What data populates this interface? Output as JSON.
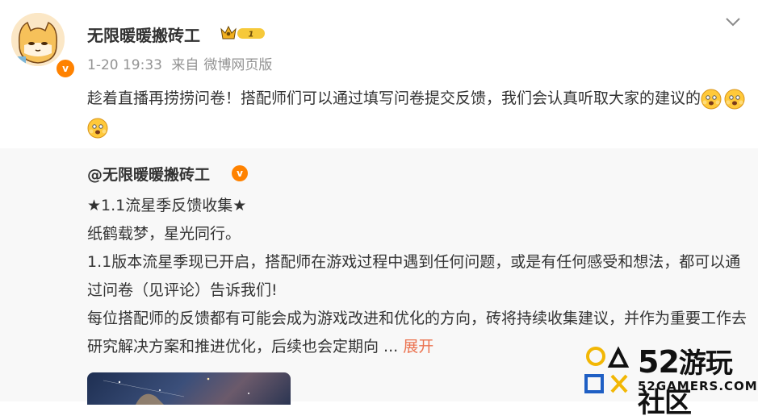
{
  "post": {
    "username": "无限暖暖搬砖工",
    "vip_level": "1",
    "time": "1-20 19:33",
    "source_prefix": "来自",
    "source": "微博网页版",
    "text": "趁着直播再捞捞问卷！搭配师们可以通过填写问卷提交反馈，我们会认真听取大家的建议的",
    "emojis": [
      "scared-face-icon",
      "scared-face-icon",
      "scared-face-icon"
    ]
  },
  "repost": {
    "author": "@无限暖暖搬砖工",
    "lines": [
      "★1.1流星季反馈收集★",
      "纸鹤载梦，星光同行。",
      "1.1版本流星季现已开启，搭配师在游戏过程中遇到任何问题，或是有任何感受和想法，都可以通过问卷（见评论）告诉我们!",
      "每位搭配师的反馈都有可能会成为游戏改进和优化的方向，砖将持续收集建议，并作为重要工作去研究解决方案和推进优化，后续也会定期向"
    ],
    "ellipsis": " ... ",
    "expand_label": "展开"
  },
  "watermark": {
    "number": "52",
    "name": "游玩社区",
    "domain": "52GAMERS.COM"
  },
  "colors": {
    "accent": "#eb7350",
    "verified": "#ff8200",
    "repost_bg": "#f8f8f8",
    "meta": "#939393"
  }
}
